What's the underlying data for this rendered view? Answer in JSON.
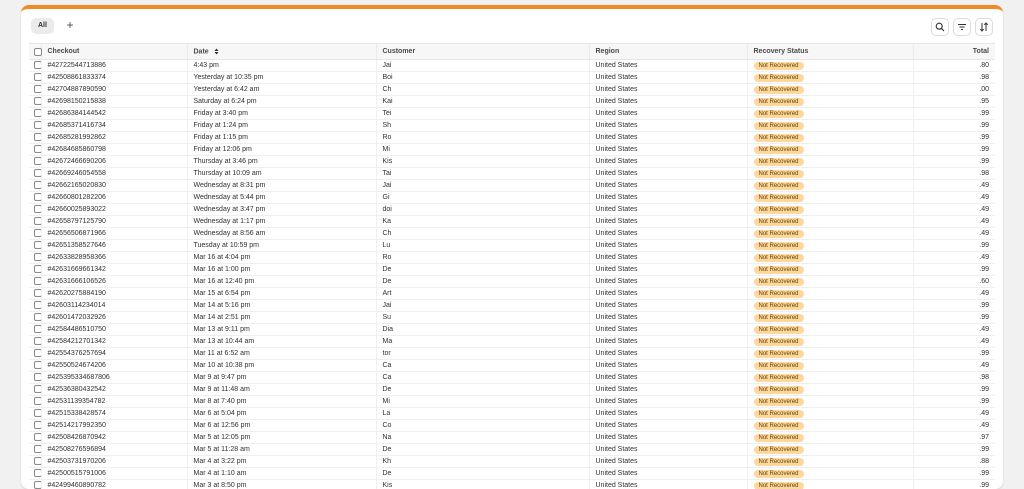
{
  "toolbar": {
    "tab_all": "All",
    "add_label": "+",
    "icons": [
      "search-icon",
      "filter-icon",
      "sort-icon"
    ]
  },
  "colors": {
    "accent": "#f08a24",
    "badge_bg": "#ffd79d",
    "badge_text": "#5e4200"
  },
  "table": {
    "columns": [
      "Checkout",
      "Date",
      "Customer",
      "Region",
      "Recovery Status",
      "Total"
    ],
    "rows": [
      [
        "#42722544713886",
        "4:43 pm",
        "Jai",
        "United States",
        "Not Recovered",
        ".80"
      ],
      [
        "#42508861833374",
        "Yesterday at 10:35 pm",
        "Boi",
        "United States",
        "Not Recovered",
        ".98"
      ],
      [
        "#42704887890590",
        "Yesterday at 6:42 am",
        "Ch",
        "United States",
        "Not Recovered",
        ".00"
      ],
      [
        "#42698150215838",
        "Saturday at 6:24 pm",
        "Kai",
        "United States",
        "Not Recovered",
        ".95"
      ],
      [
        "#42686384144542",
        "Friday at 3:40 pm",
        "Tei",
        "United States",
        "Not Recovered",
        ".99"
      ],
      [
        "#42685371416734",
        "Friday at 1:24 pm",
        "Sh",
        "United States",
        "Not Recovered",
        ".99"
      ],
      [
        "#42685281992862",
        "Friday at 1:15 pm",
        "Ro",
        "United States",
        "Not Recovered",
        ".99"
      ],
      [
        "#42684685860798",
        "Friday at 12:06 pm",
        "Mi",
        "United States",
        "Not Recovered",
        ".99"
      ],
      [
        "#42672466690206",
        "Thursday at 3:46 pm",
        "Kis",
        "United States",
        "Not Recovered",
        ".99"
      ],
      [
        "#42669246054558",
        "Thursday at 10:09 am",
        "Tai",
        "United States",
        "Not Recovered",
        ".98"
      ],
      [
        "#42662165020830",
        "Wednesday at 8:31 pm",
        "Jai",
        "United States",
        "Not Recovered",
        ".49"
      ],
      [
        "#42660801282206",
        "Wednesday at 5:44 pm",
        "Gi",
        "United States",
        "Not Recovered",
        ".49"
      ],
      [
        "#42660025893022",
        "Wednesday at 3:47 pm",
        "doi",
        "United States",
        "Not Recovered",
        ".49"
      ],
      [
        "#42658797125790",
        "Wednesday at 1:17 pm",
        "Ka",
        "United States",
        "Not Recovered",
        ".49"
      ],
      [
        "#42656506871966",
        "Wednesday at 8:56 am",
        "Ch",
        "United States",
        "Not Recovered",
        ".49"
      ],
      [
        "#42651358527646",
        "Tuesday at 10:59 pm",
        "Lu",
        "United States",
        "Not Recovered",
        ".99"
      ],
      [
        "#42633828958366",
        "Mar 16 at 4:04 pm",
        "Ro",
        "United States",
        "Not Recovered",
        ".49"
      ],
      [
        "#42631669661342",
        "Mar 16 at 1:00 pm",
        "De",
        "United States",
        "Not Recovered",
        ".99"
      ],
      [
        "#42631666106526",
        "Mar 16 at 12:40 pm",
        "De",
        "United States",
        "Not Recovered",
        ".60"
      ],
      [
        "#42620275884190",
        "Mar 15 at 6:54 pm",
        "Art",
        "United States",
        "Not Recovered",
        ".49"
      ],
      [
        "#42603114234014",
        "Mar 14 at 5:16 pm",
        "Jai",
        "United States",
        "Not Recovered",
        ".99"
      ],
      [
        "#42601472032926",
        "Mar 14 at 2:51 pm",
        "Su",
        "United States",
        "Not Recovered",
        ".99"
      ],
      [
        "#42584486510750",
        "Mar 13 at 9:11 pm",
        "Dia",
        "United States",
        "Not Recovered",
        ".49"
      ],
      [
        "#42584212701342",
        "Mar 13 at 10:44 am",
        "Ma",
        "United States",
        "Not Recovered",
        ".49"
      ],
      [
        "#42554376257694",
        "Mar 11 at 6:52 am",
        "tor",
        "United States",
        "Not Recovered",
        ".99"
      ],
      [
        "#42550524674206",
        "Mar 10 at 10:38 pm",
        "Ca",
        "United States",
        "Not Recovered",
        ".49"
      ],
      [
        "#425395334687806",
        "Mar 9 at 9:47 pm",
        "Ca",
        "United States",
        "Not Recovered",
        ".98"
      ],
      [
        "#42536380432542",
        "Mar 9 at 11:48 am",
        "De",
        "United States",
        "Not Recovered",
        ".99"
      ],
      [
        "#42531139354782",
        "Mar 8 at 7:40 pm",
        "Mi",
        "United States",
        "Not Recovered",
        ".99"
      ],
      [
        "#42515338428574",
        "Mar 6 at 5:04 pm",
        "La",
        "United States",
        "Not Recovered",
        ".49"
      ],
      [
        "#42514217992350",
        "Mar 6 at 12:56 pm",
        "Co",
        "United States",
        "Not Recovered",
        ".49"
      ],
      [
        "#42508426870942",
        "Mar 5 at 12:05 pm",
        "Na",
        "United States",
        "Not Recovered",
        ".97"
      ],
      [
        "#42508276596894",
        "Mar 5 at 11:28 am",
        "De",
        "United States",
        "Not Recovered",
        ".99"
      ],
      [
        "#42503731970206",
        "Mar 4 at 3:22 pm",
        "Kh",
        "United States",
        "Not Recovered",
        ".88"
      ],
      [
        "#42500515791006",
        "Mar 4 at 1:10 am",
        "De",
        "United States",
        "Not Recovered",
        ".99"
      ],
      [
        "#42499460890782",
        "Mar 3 at 8:50 pm",
        "Kis",
        "United States",
        "Not Recovered",
        ".99"
      ]
    ]
  }
}
